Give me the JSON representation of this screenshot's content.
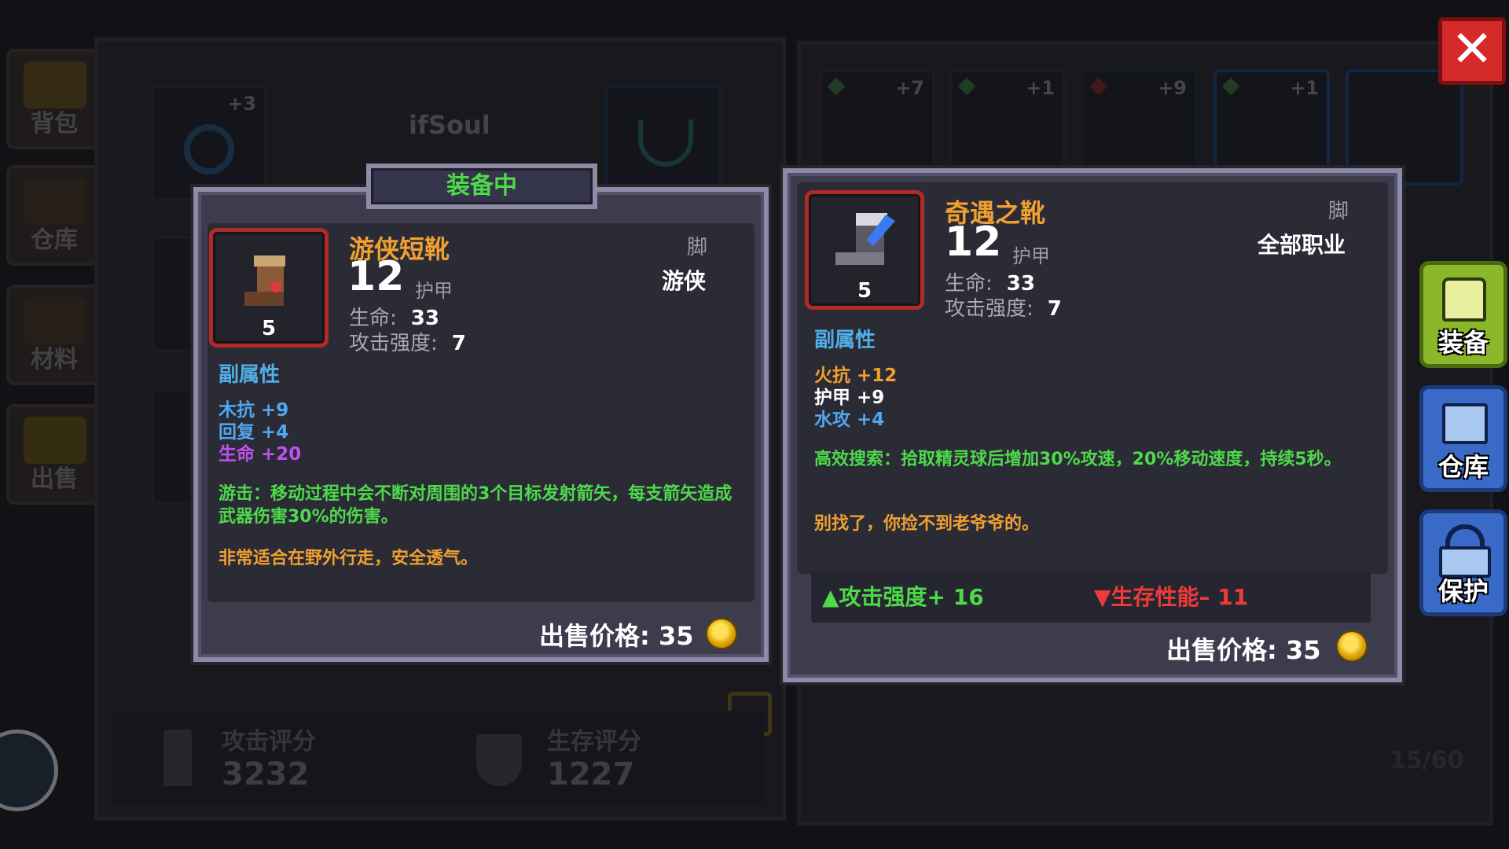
{
  "close_button": {
    "label": "✕"
  },
  "side_tabs": [
    {
      "label": "背包"
    },
    {
      "label": "仓库"
    },
    {
      "label": "材料"
    },
    {
      "label": "出售"
    }
  ],
  "player_name": "ifSoul",
  "left_slot_bonus": "+3",
  "inventory_slots": [
    {
      "bonus": "+7"
    },
    {
      "bonus": "+1"
    },
    {
      "bonus": "+9"
    },
    {
      "bonus": "+1"
    }
  ],
  "inventory_count": "15/60",
  "scores": {
    "attack_label": "攻击评分",
    "attack_value": "3232",
    "survival_label": "生存评分",
    "survival_value": "1227"
  },
  "equipped_tag": "装备中",
  "equipped_item": {
    "name": "游侠短靴",
    "slot": "脚",
    "class": "游侠",
    "level": "5",
    "armor_value": "12",
    "armor_label": "护甲",
    "hp_label": "生命:",
    "hp_value": "33",
    "atk_label": "攻击强度:",
    "atk_value": "7",
    "sub_title": "副属性",
    "sub_attrs": [
      {
        "text": "木抗 +9",
        "color": "#4fa8f0"
      },
      {
        "text": "回复 +4",
        "color": "#4fa8f0"
      },
      {
        "text": "生命 +20",
        "color": "#c050f0"
      }
    ],
    "effect": "游击：移动过程中会不断对周围的3个目标发射箭矢，每支箭矢造成武器伤害30%的伤害。",
    "flavor": "非常适合在野外行走，安全透气。",
    "price_label": "出售价格: 35"
  },
  "new_item": {
    "name": "奇遇之靴",
    "slot": "脚",
    "class": "全部职业",
    "level": "5",
    "armor_value": "12",
    "armor_label": "护甲",
    "hp_label": "生命:",
    "hp_value": "33",
    "atk_label": "攻击强度:",
    "atk_value": "7",
    "sub_title": "副属性",
    "sub_attrs": [
      {
        "text": "火抗 +12",
        "color": "#f0a030"
      },
      {
        "text": "护甲 +9",
        "color": "#ffffff"
      },
      {
        "text": "水攻 +4",
        "color": "#4fa8f0"
      }
    ],
    "effect": "高效搜索：拾取精灵球后增加30%攻速，20%移动速度，持续5秒。",
    "flavor": "别找了，你捡不到老爷爷的。",
    "compare_up": "攻击强度+ 16",
    "compare_down": "生存性能– 11",
    "price_label": "出售价格: 35"
  },
  "actions": [
    {
      "label": "装备"
    },
    {
      "label": "仓库"
    },
    {
      "label": "保护"
    }
  ],
  "colors": {
    "equipped_green": "#4ed94a",
    "item_name_orange": "#f0a030",
    "sub_title_blue": "#4fb0e8",
    "effect_green": "#4ed94a",
    "flavor_orange": "#f0a030",
    "up_green": "#4ed94a",
    "down_red": "#f03a3a"
  }
}
